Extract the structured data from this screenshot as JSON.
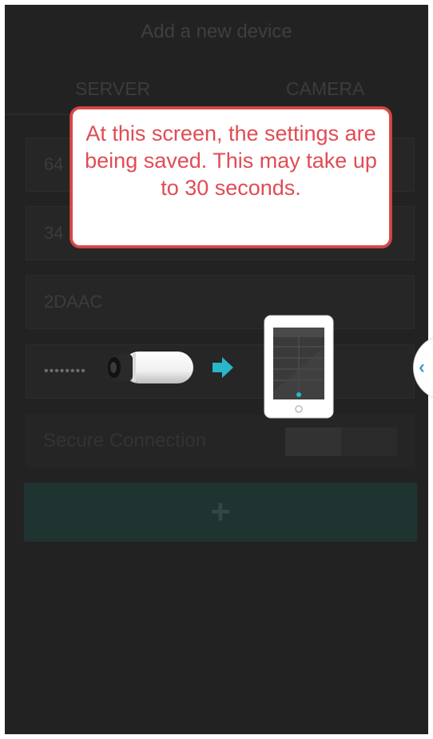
{
  "screen": {
    "title": "Add a new device"
  },
  "tabs": [
    {
      "label": "SERVER"
    },
    {
      "label": "CAMERA"
    }
  ],
  "fields": {
    "field1_value": "64",
    "field2_value": "34",
    "field3_value": "2DAAC",
    "password_masked": "••••••••"
  },
  "secure_connection": {
    "label": "Secure Connection",
    "enabled": false
  },
  "add_button": {
    "label": "+"
  },
  "callout": {
    "text": "At this screen, the settings are being saved. This may take up to 30 seconds."
  },
  "side_handle": {
    "icon": "chevron-left-icon",
    "glyph": "‹"
  },
  "colors": {
    "accent": "#29b6c8",
    "callout_border": "#d64a4a",
    "callout_text": "#e04c54",
    "background": "#222222"
  }
}
